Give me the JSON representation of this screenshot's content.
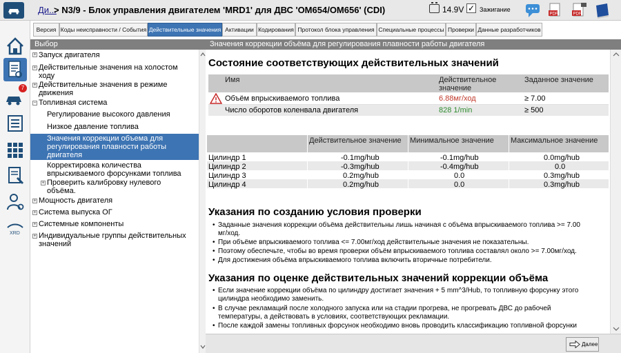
{
  "titlebar": {
    "breadcrumb_link": "Ди...",
    "title": "> N3/9 - Блок управления двигателем 'MRD1' для ДВС 'OM654/OM656' (CDI)",
    "voltage": "14.9V",
    "ignition_label": "Зажигание",
    "ignition_check": "✓"
  },
  "tabs": [
    {
      "label": "Версия"
    },
    {
      "label": "Коды неисправности / События"
    },
    {
      "label": "Действительные значения"
    },
    {
      "label": "Активации"
    },
    {
      "label": "Кодирования"
    },
    {
      "label": "Протокол блока управления"
    },
    {
      "label": "Специальные процессы"
    },
    {
      "label": "Проверки"
    },
    {
      "label": "Данные разработчиков"
    }
  ],
  "rail": {
    "badge_count": "7",
    "xrd_label": "XRD"
  },
  "leftpanel": {
    "header": "Выбор",
    "items": [
      {
        "label": "Запуск двигателя",
        "exp": "+"
      },
      {
        "label": "Действительные значения на холостом",
        "label2": "ходу",
        "exp": "+"
      },
      {
        "label": "Действительные значения в режиме",
        "label2": "движения",
        "exp": "+"
      },
      {
        "label": "Топливная система",
        "exp": "−"
      },
      {
        "label": "Регулирование высокого давления"
      },
      {
        "label": "Низкое давление топлива"
      },
      {
        "label": "Значения коррекции объема для",
        "label2": "регулирования плавности работы",
        "label3": "двигателя"
      },
      {
        "label": "Корректировка количества",
        "label2": "впрыскиваемого форсунками топлива"
      },
      {
        "label": "Проверить калибровку нулевого",
        "label2": "объёма.",
        "exp": "+"
      },
      {
        "label": "Мощность двигателя",
        "exp": "+"
      },
      {
        "label": "Система выпуска ОГ",
        "exp": "+"
      },
      {
        "label": "Системные компоненты",
        "exp": "+"
      },
      {
        "label": "Индивидуальные группы действительных",
        "label2": "значений",
        "exp": "+"
      }
    ]
  },
  "main": {
    "header": "Значения коррекции объёма для регулирования плавности работы двигателя",
    "section1_title": "Состояние соответствующих действительных значений",
    "t1_headers": {
      "name": "Имя",
      "actual": "Действительное",
      "actual2": "значение",
      "target": "Заданное значение"
    },
    "t1_rows": [
      {
        "name": "Объём впрыскиваемого топлива",
        "actual": "6.88мг/ход",
        "target": "≥ 7.00",
        "actual_color": "#c0392b"
      },
      {
        "name": "Число оборотов коленвала двигателя",
        "actual": "828 1/min",
        "target": "≥ 500",
        "actual_color": "#2e8b2e"
      }
    ],
    "t2_headers": {
      "actual": "Действительное значение",
      "min": "Минимальное значение",
      "max": "Максимальное значение"
    },
    "t2_rows": [
      {
        "name": "Цилиндр 1",
        "actual": "-0.1mg/hub",
        "min": "-0.1mg/hub",
        "max": "0.0mg/hub"
      },
      {
        "name": "Цилиндр 2",
        "actual": "-0.3mg/hub",
        "min": "-0.4mg/hub",
        "max": "0.0"
      },
      {
        "name": "Цилиндр 3",
        "actual": "0.2mg/hub",
        "min": "0.0",
        "max": "0.3mg/hub"
      },
      {
        "name": "Цилиндр 4",
        "actual": "0.2mg/hub",
        "min": "0.0",
        "max": "0.3mg/hub"
      }
    ],
    "section2_title": "Указания по созданию условия проверки",
    "section2_bullets": [
      {
        "l1": "Заданные значения коррекции объёма действительны лишь начиная с объёма впрыскиваемого топлива >= 7.00",
        "l2": "мг/ход."
      },
      {
        "l1": "При объёме впрыскиваемого топлива <= 7.00мг/ход действительные значения не показательны."
      },
      {
        "l1": "Поэтому обеспечьте, чтобы во время проверки объём впрыскиваемого топлива составлял около >= 7.00мг/ход."
      },
      {
        "l1": "Для достижения объёма впрыскиваемого топлива включить вторичные потребители."
      }
    ],
    "section3_title": "Указания по оценке действительных значений коррекции объёма",
    "section3_bullets": [
      {
        "l1": "Если значение коррекции объёма по цилиндру достигает значения + 5 mm^3/Hub, то топливную форсунку этого",
        "l2": "цилиндра необходимо заменить."
      },
      {
        "l1": "В случае рекламаций после холодного запуска или на стадии прогрева, не прогревать ДВС до рабочей",
        "l2": "температуры, а действовать в условиях, соответствующих рекламации."
      },
      {
        "l1": "После каждой замены топливных форсунок необходимо вновь проводить классификацию топливной форсунки"
      }
    ],
    "next_label": "Далее"
  },
  "colors": {
    "accent": "#3d74b3",
    "header_gray": "#7f7f7f",
    "table_header": "#c8c8c8"
  }
}
